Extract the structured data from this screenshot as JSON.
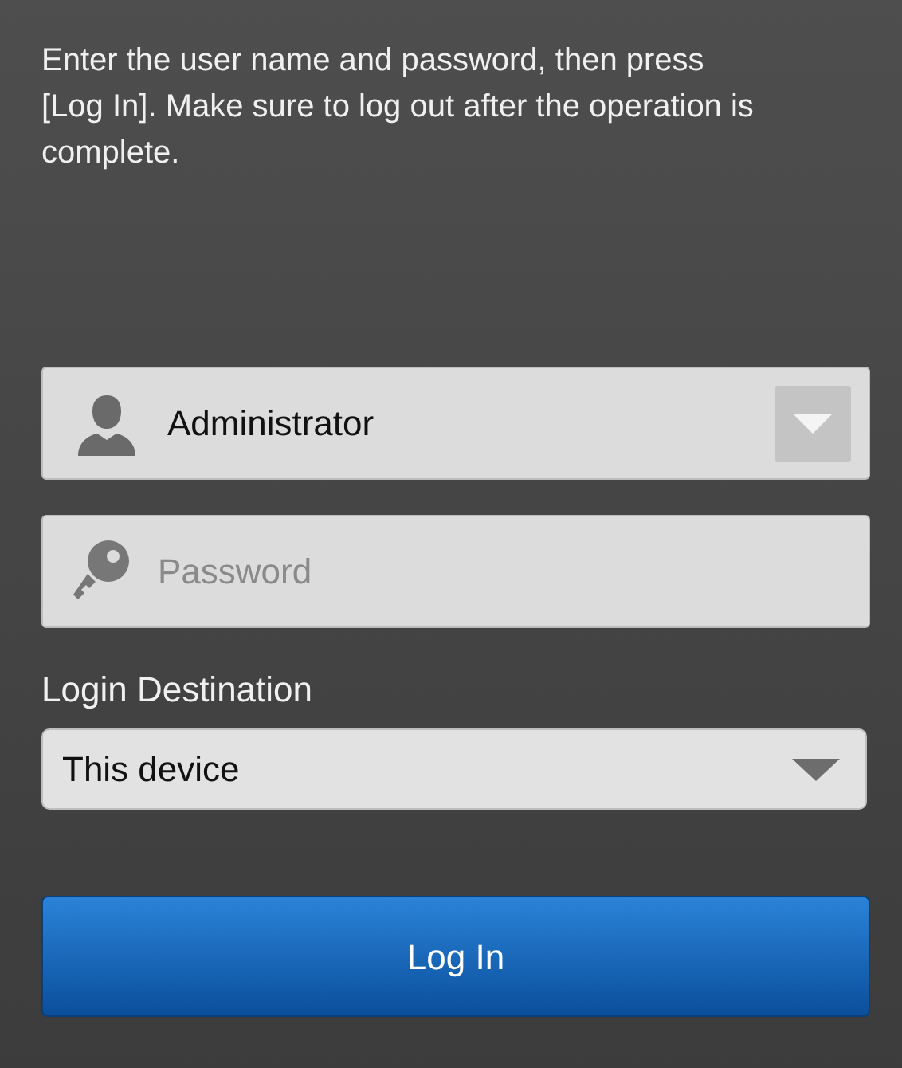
{
  "instructions": "Enter the user name and password, then press [Log In]. Make sure to log out after the operation is complete.",
  "user_field": {
    "value": "Administrator"
  },
  "password_field": {
    "placeholder": "Password"
  },
  "destination": {
    "label": "Login Destination",
    "value": "This device"
  },
  "login_button": {
    "label": "Log In"
  }
}
